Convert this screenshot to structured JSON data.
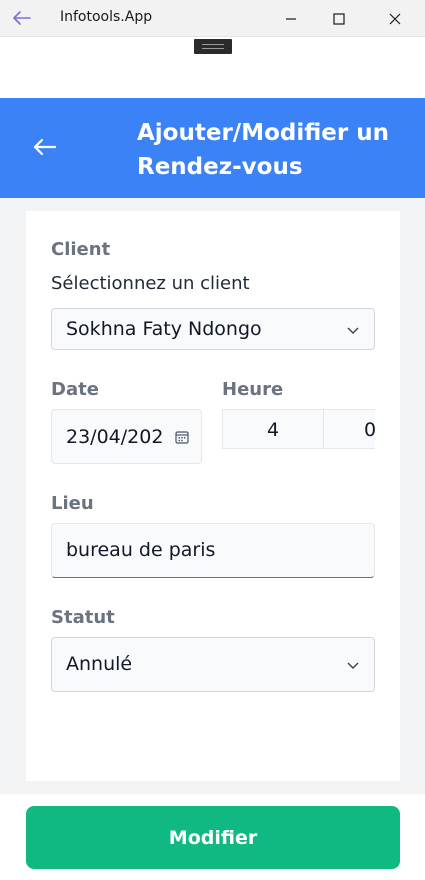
{
  "window": {
    "title": "Infotools.App"
  },
  "header": {
    "title": "Ajouter/Modifier un Rendez-vous",
    "color": "#3b82f6"
  },
  "form": {
    "client": {
      "label": "Client",
      "sublabel": "Sélectionnez un client",
      "selected": "Sokhna Faty Ndongo"
    },
    "date": {
      "label": "Date",
      "value": "23/04/202"
    },
    "heure": {
      "label": "Heure",
      "hour": "4",
      "minute": "0"
    },
    "lieu": {
      "label": "Lieu",
      "value": "bureau de paris"
    },
    "statut": {
      "label": "Statut",
      "selected": "Annulé"
    }
  },
  "actions": {
    "submit_label": "Modifier",
    "submit_color": "#10b981"
  }
}
